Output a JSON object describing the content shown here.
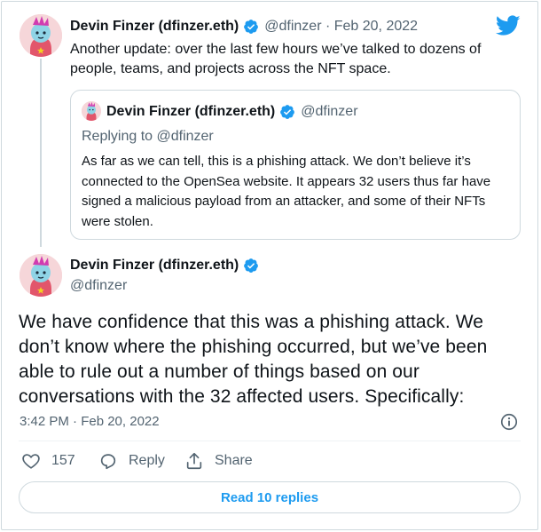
{
  "colors": {
    "accent": "#1d9bf0",
    "text": "#0f1419",
    "muted": "#536471",
    "border": "#cfd9de"
  },
  "tweet_top": {
    "author_name": "Devin Finzer (dfinzer.eth)",
    "handle_date": "@dfinzer · Feb 20, 2022",
    "text": "Another update: over the last few hours we’ve talked to dozens of people, teams, and projects across the NFT space."
  },
  "quoted": {
    "author_name": "Devin Finzer (dfinzer.eth)",
    "handle": "@dfinzer",
    "replying_to": "Replying to @dfinzer",
    "text": "As far as we can tell, this is a phishing attack. We don’t believe it’s connected to the OpenSea website. It appears 32 users thus far have signed a malicious payload from an attacker, and some of their NFTs were stolen."
  },
  "main_tweet": {
    "author_name": "Devin Finzer (dfinzer.eth)",
    "handle": "@dfinzer",
    "text": "We have confidence that this was a phishing attack. We don’t know where the phishing occurred, but we’ve been able to rule out a number of things based on our conversations with the 32 affected users. Specifically:",
    "timestamp": "3:42 PM · Feb 20, 2022"
  },
  "actions": {
    "like_count": "157",
    "reply_label": "Reply",
    "share_label": "Share"
  },
  "read_replies": "Read 10 replies",
  "icons": [
    "twitter-bird-icon",
    "verified-badge-icon",
    "info-icon",
    "heart-icon",
    "reply-icon",
    "share-icon"
  ]
}
